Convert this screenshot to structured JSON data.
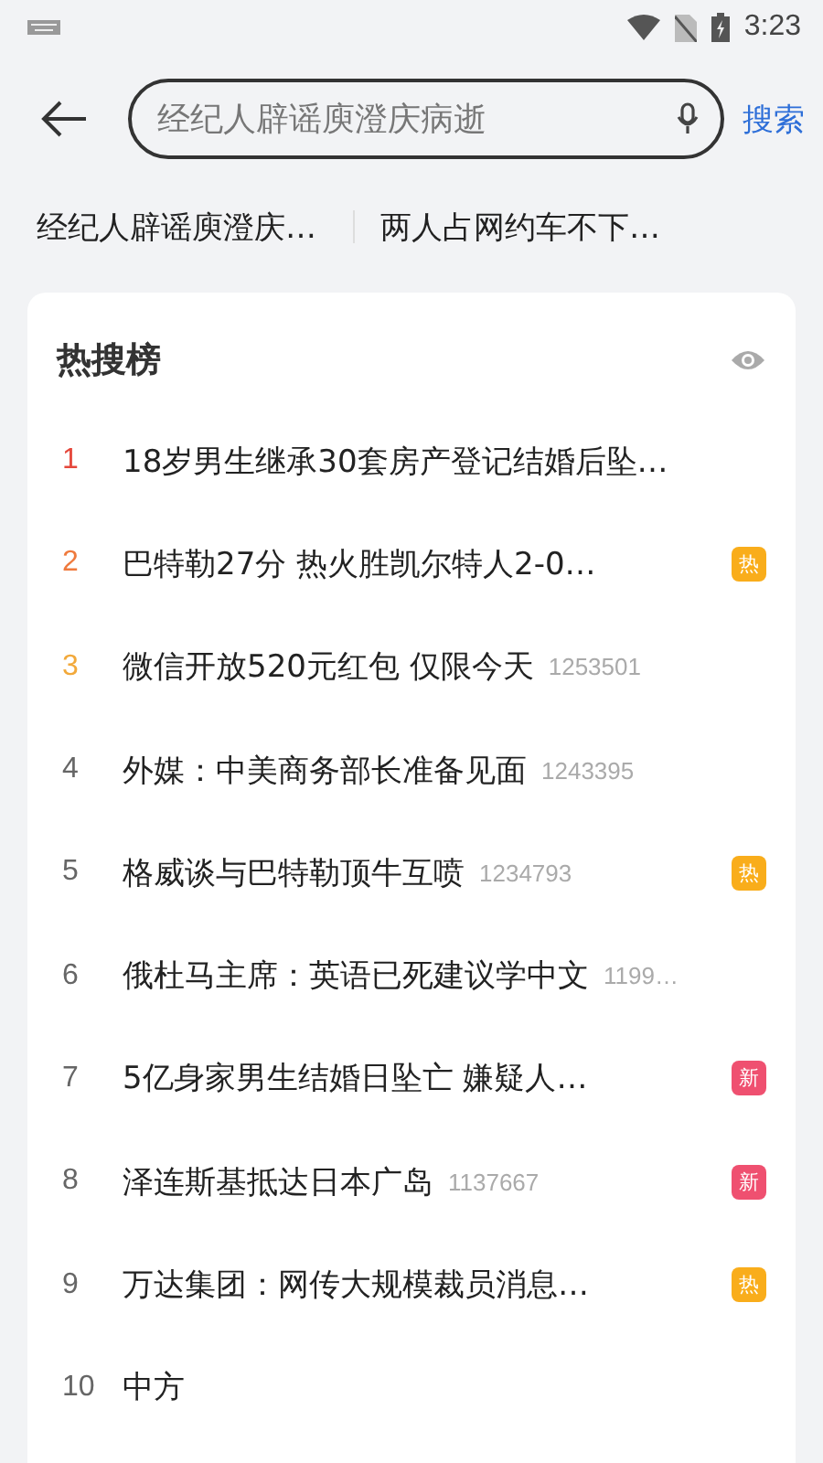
{
  "status_bar": {
    "time": "3:23"
  },
  "search": {
    "value": "经纪人辟谣庾澄庆病逝",
    "button": "搜索"
  },
  "suggestions": [
    "经纪人辟谣庾澄庆…",
    "两人占网约车不下…"
  ],
  "hot_list": {
    "title": "热搜榜",
    "items": [
      {
        "rank": "1",
        "color": "#e5483c",
        "title": "18岁男生继承30套房产登记结婚后坠…"
      },
      {
        "rank": "2",
        "color": "#ef7a3d",
        "title": "巴特勒27分 热火胜凯尔特人2-0…",
        "badge": {
          "kind": "hot",
          "label": "热"
        }
      },
      {
        "rank": "3",
        "color": "#f2a93b",
        "title": "微信开放520元红包 仅限今天",
        "count": "1253501"
      },
      {
        "rank": "4",
        "color": "#666666",
        "title": "外媒：中美商务部长准备见面",
        "count": "1243395"
      },
      {
        "rank": "5",
        "color": "#666666",
        "title": "格威谈与巴特勒顶牛互喷",
        "count": "1234793",
        "badge": {
          "kind": "hot",
          "label": "热"
        }
      },
      {
        "rank": "6",
        "color": "#666666",
        "title": "俄杜马主席：英语已死建议学中文",
        "count": "1199…"
      },
      {
        "rank": "7",
        "color": "#666666",
        "title": "5亿身家男生结婚日坠亡 嫌疑人…",
        "badge": {
          "kind": "new",
          "label": "新"
        }
      },
      {
        "rank": "8",
        "color": "#666666",
        "title": "泽连斯基抵达日本广岛",
        "count": "1137667",
        "badge": {
          "kind": "new",
          "label": "新"
        }
      },
      {
        "rank": "9",
        "color": "#666666",
        "title": "万达集团：网传大规模裁员消息…",
        "badge": {
          "kind": "hot",
          "label": "热"
        }
      },
      {
        "rank": "10",
        "color": "#666666",
        "title": "中方"
      }
    ]
  }
}
